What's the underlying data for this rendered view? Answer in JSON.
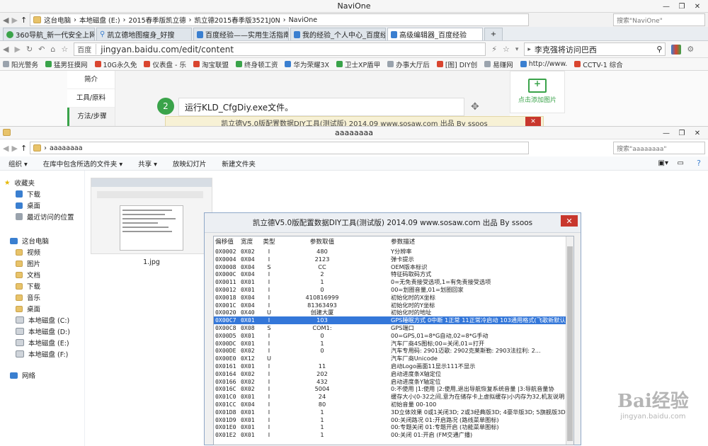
{
  "browser": {
    "title": "NaviOne",
    "breadcrumb": [
      "这台电脑",
      "本地磁盘 (E:)",
      "2015春季版凯立德",
      "凯立德2015春季版3521J0N",
      "NaviOne"
    ],
    "search_placeholder": "搜索\"NaviOne\"",
    "tabs": [
      {
        "label": "360导航_新一代安全上网导"
      },
      {
        "label": "凯立德地图瘦身_好搜"
      },
      {
        "label": "百度经验——实用生活指南"
      },
      {
        "label": "我的经验_个人中心_百度经验"
      },
      {
        "label": "高级编辑器_百度经验"
      }
    ],
    "new_tab": "+",
    "site_label": "百度",
    "url": "jingyan.baidu.com/edit/content",
    "search_box": "李克强将访问巴西",
    "bookmarks": [
      "阳光警务",
      "猛男狂摸网",
      "10G永久免",
      "仪表盘 - 乐",
      "淘宝联盟",
      "终身顿工资",
      "华为荣耀3X",
      "卫士XP盾甲",
      "办事大厅后",
      "[图] DIY创",
      "易赚网",
      "http://www.",
      "CCTV-1 综合"
    ],
    "side_menu": [
      "简介",
      "工具/原料",
      "方法/步骤"
    ],
    "step_number": "2",
    "step_text": "运行KLD_CfgDiy.exe文件。",
    "add_image": "点击添加图片",
    "move_icon": "✥",
    "bg_title": "凯立德V5.0版配置数据DIY工具(测试版) 2014.09  www.sosaw.com 出品 By ssoos"
  },
  "explorer": {
    "title": "aaaaaaaa",
    "path": "aaaaaaaa",
    "search_placeholder": "搜索\"aaaaaaaa\"",
    "commands": [
      "组织 ▾",
      "在库中包含所选的文件夹 ▾",
      "共享 ▾",
      "放映幻灯片",
      "新建文件夹"
    ],
    "favorites_label": "收藏夹",
    "favorites": [
      "下载",
      "桌面",
      "最近访问的位置"
    ],
    "pc_label": "这台电脑",
    "pc_items": [
      "视频",
      "图片",
      "文档",
      "下载",
      "音乐",
      "桌面",
      "本地磁盘 (C:)",
      "本地磁盘 (D:)",
      "本地磁盘 (E:)",
      "本地磁盘 (F:)"
    ],
    "network_label": "网络",
    "file_name": "1.jpg"
  },
  "dialog": {
    "title": "凯立德V5.0版配置数据DIY工具(测试版) 2014.09  www.sosaw.com 出品 By ssoos",
    "close": "✕",
    "headers": [
      "偏移值",
      "宽度",
      "类型",
      "参数取值",
      "参数描述"
    ],
    "rows": [
      [
        "0X0002",
        "0X02",
        "I",
        "480",
        "Y分辨率"
      ],
      [
        "0X0004",
        "0X04",
        "I",
        "2123",
        "弹卡提示"
      ],
      [
        "0X0008",
        "0X04",
        "S",
        "CC",
        "OEM版本标识"
      ],
      [
        "0X000C",
        "0X04",
        "I",
        "2",
        "特征码取码方式"
      ],
      [
        "0X0011",
        "0X01",
        "I",
        "1",
        "0=无免责接受选项,1=有免责接受选项"
      ],
      [
        "0X0012",
        "0X01",
        "I",
        "0",
        "00=划圈音量,01=划圈回家"
      ],
      [
        "0X0018",
        "0X04",
        "I",
        "410816999",
        "初始化时的X坐标"
      ],
      [
        "0X001C",
        "0X04",
        "I",
        "81363493",
        "初始化时的Y坐标"
      ],
      [
        "0X0020",
        "0X40",
        "U",
        "创建大厦",
        "初始化时的地址"
      ],
      [
        "0X00C7",
        "0X01",
        "I",
        "103",
        "GPS睡眠方式 0中断 1正常 11正常冷启动 103通用格式(飞歌新默认此项"
      ],
      [
        "0X00C8",
        "0X08",
        "S",
        "COM1:",
        "GPS端口"
      ],
      [
        "0X00D5",
        "0X01",
        "I",
        "0",
        "00=GPS,01=8*G自动,02=8*G手动"
      ],
      [
        "0X00DC",
        "0X01",
        "I",
        "1",
        "汽车厂商4S图标;00=关闭,01=打开"
      ],
      [
        "0X00DE",
        "0X02",
        "I",
        "0",
        "汽车专用码: 2901迈歌:      2902克莱斯勒:    2903法拉利:     2..."
      ],
      [
        "0X00E0",
        "0X12",
        "U",
        "",
        "汽车厂商Unicode"
      ],
      [
        "0X0161",
        "0X01",
        "I",
        "11",
        "启动Logo画面11显示111不显示"
      ],
      [
        "0X0164",
        "0X02",
        "I",
        "202",
        "启动进度条X轴定位"
      ],
      [
        "0X0166",
        "0X02",
        "I",
        "432",
        "启动进度条Y轴定位"
      ],
      [
        "0X016C",
        "0X02",
        "I",
        "5004",
        "0:不使用  |1:使用  |2:使用,退出导航恢复系统音量  |3:导航音量协"
      ],
      [
        "0X01C0",
        "0X01",
        "I",
        "24",
        "缓存大小(0-32之间,意为在储存卡上虚拟缓存)小内存为32,机友说明"
      ],
      [
        "0X01CC",
        "0X04",
        "I",
        "80",
        "初始音量 00-100"
      ],
      [
        "0X01D8",
        "0X01",
        "I",
        "1",
        "3D立体效果 0或1关闭3D; 2或3经典版3D; 4豪华版3D; 5旗舰版3D; 6"
      ],
      [
        "0X01D9",
        "0X01",
        "I",
        "1",
        "00:关闭路况  01:开启路况 (路线菜单图标)"
      ],
      [
        "0X01E0",
        "0X01",
        "I",
        "1",
        "00:专题关闭  01:专题开启  (功能菜单图标)"
      ],
      [
        "0X01E2",
        "0X01",
        "I",
        "1",
        "00:关闭  01:开启  (FM交通广播)"
      ]
    ],
    "selected_row": 9
  },
  "watermark": {
    "text": "Bai经验",
    "sub": "jingyan.baidu.com"
  }
}
